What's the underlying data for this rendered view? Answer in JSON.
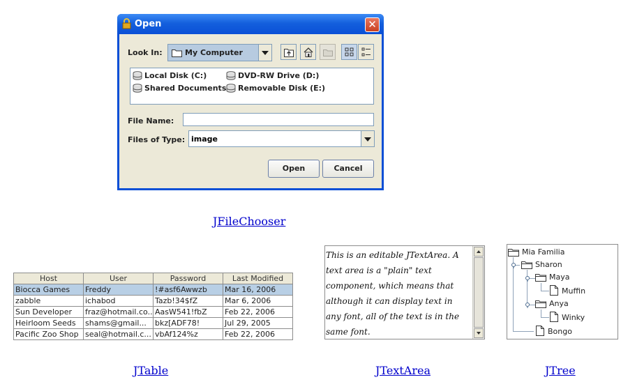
{
  "dialog": {
    "title": "Open",
    "close_glyph": "✕",
    "look_in_label": "Look In:",
    "look_in_value": "My Computer",
    "file_items": [
      {
        "label": "Local Disk (C:)",
        "icon": "disk-icon"
      },
      {
        "label": "DVD-RW Drive (D:)",
        "icon": "disk-icon"
      },
      {
        "label": "Shared Documents",
        "icon": "disk-icon"
      },
      {
        "label": "Removable Disk (E:)",
        "icon": "disk-icon"
      }
    ],
    "file_name_label": "File Name:",
    "file_name_value": "",
    "files_of_type_label": "Files of Type:",
    "files_of_type_value": "image",
    "open_button": "Open",
    "cancel_button": "Cancel"
  },
  "captions": {
    "filechooser": "JFileChooser",
    "table": "JTable",
    "textarea": "JTextArea",
    "tree": "JTree"
  },
  "table": {
    "columns": [
      "Host",
      "User",
      "Password",
      "Last Modified"
    ],
    "rows": [
      [
        "Biocca Games",
        "Freddy",
        "!#asf6Awwzb",
        "Mar 16, 2006"
      ],
      [
        "zabble",
        "ichabod",
        "Tazb!34$fZ",
        "Mar 6, 2006"
      ],
      [
        "Sun Developer",
        "fraz@hotmail.co...",
        "AasW541!fbZ",
        "Feb 22, 2006"
      ],
      [
        "Heirloom Seeds",
        "shams@gmail...",
        "bkz[ADF78!",
        "Jul 29, 2005"
      ],
      [
        "Pacific Zoo Shop",
        "seal@hotmail.c...",
        "vbAf124%z",
        "Feb 22, 2006"
      ]
    ],
    "selected_row": 0
  },
  "textarea": {
    "lines": [
      "This is an editable JTextArea. A",
      "text area is a \"plain\" text",
      "component, which means that",
      "although it can display text in",
      "any font, all of the text is in the",
      "same font."
    ]
  },
  "tree": {
    "nodes": [
      {
        "label": "Mia Familia",
        "icon": "folder-icon"
      },
      {
        "label": "Sharon",
        "icon": "folder-icon"
      },
      {
        "label": "Maya",
        "icon": "folder-icon"
      },
      {
        "label": "Muffin",
        "icon": "file-icon"
      },
      {
        "label": "Anya",
        "icon": "folder-icon"
      },
      {
        "label": "Winky",
        "icon": "file-icon"
      },
      {
        "label": "Bongo",
        "icon": "file-icon"
      }
    ]
  }
}
